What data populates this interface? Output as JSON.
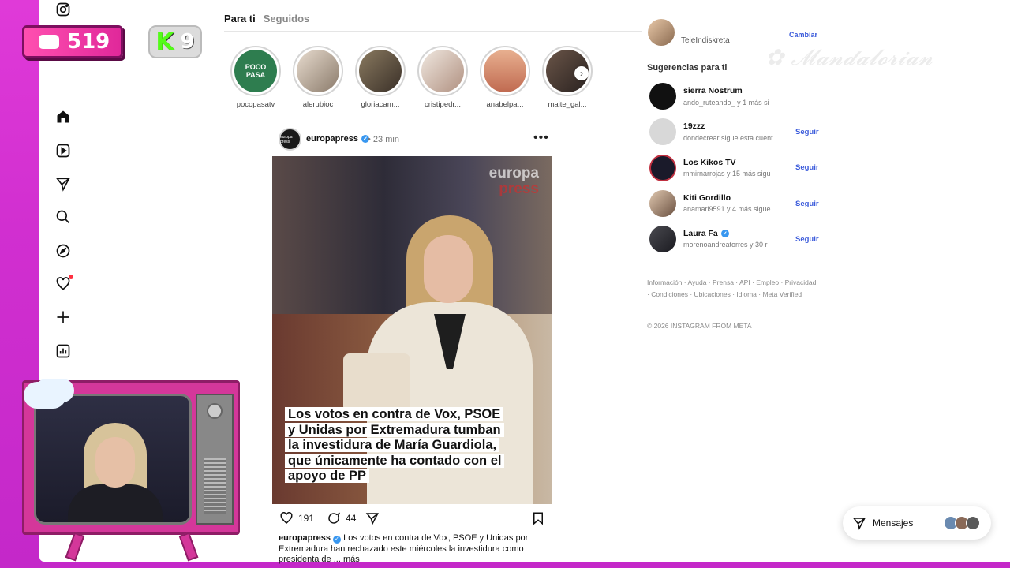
{
  "overlay": {
    "chat_count": "519",
    "kick_count": "9",
    "kick_letter": "K",
    "signature_text": "Mandalorian"
  },
  "nav": {
    "icons": [
      "instagram-icon",
      "home-icon",
      "reels-icon",
      "messages-icon",
      "search-icon",
      "explore-icon",
      "notifications-icon",
      "create-icon",
      "dashboard-icon"
    ]
  },
  "feed": {
    "tabs": [
      "Para ti",
      "Seguidos"
    ],
    "stories": [
      {
        "name": "pocopasatv",
        "color": "#2e7d4f"
      },
      {
        "name": "alerubioc",
        "color": "#c9b8a8"
      },
      {
        "name": "gloriacam...",
        "color": "#6d5a45"
      },
      {
        "name": "cristipedr...",
        "color": "#d9c8b8"
      },
      {
        "name": "anabelpa...",
        "color": "#d99470"
      },
      {
        "name": "maite_gal...",
        "color": "#4a3a32"
      }
    ],
    "story_logo": "POCO PASA",
    "post": {
      "avatar_text": "europa press",
      "username": "europapress",
      "time": "23 min",
      "watermark_1": "europa",
      "watermark_2": "press",
      "headline": "Los votos en contra de Vox, PSOE y Unidas por Extremadura tumban la investidura de María Guardiola, que únicamente ha contado con el apoyo de PP",
      "likes": "191",
      "comments": "44",
      "caption_user": "europapress",
      "caption_text": "Los votos en contra de Vox, PSOE y Unidas por Extremadura han rechazado este miércoles la investidura como presidenta de ... más"
    }
  },
  "sidebar": {
    "current_user": "TeleIndiskreta",
    "switch_label": "Cambiar",
    "suggestions_title": "Sugerencias para ti",
    "follow_label": "Seguir",
    "suggestions": [
      {
        "name": "sierra Nostrum",
        "sub": "ando_ruteando_ y 1 más si",
        "verified": false,
        "color": "#111111"
      },
      {
        "name": "19zzz",
        "sub": "dondecrear sigue esta cuent",
        "verified": false,
        "color": "#d8d8d8"
      },
      {
        "name": "Los Kikos TV",
        "sub": "mmirnarrojas y 15 más sigu",
        "verified": false,
        "color": "#1a1a2a"
      },
      {
        "name": "Kiti Gordillo",
        "sub": "anamari9591 y 4 más sigue",
        "verified": false,
        "color": "#b89a80"
      },
      {
        "name": "Laura Fa",
        "sub": "morenoandreatorres y 30 r",
        "verified": true,
        "color": "#2a2a30"
      }
    ],
    "footer_links": "Información · Ayuda · Prensa · API · Empleo · Privacidad · Condiciones · Ubicaciones · Idioma · Meta Verified",
    "copyright": "© 2026 INSTAGRAM FROM META"
  },
  "messages": {
    "label": "Mensajes"
  }
}
